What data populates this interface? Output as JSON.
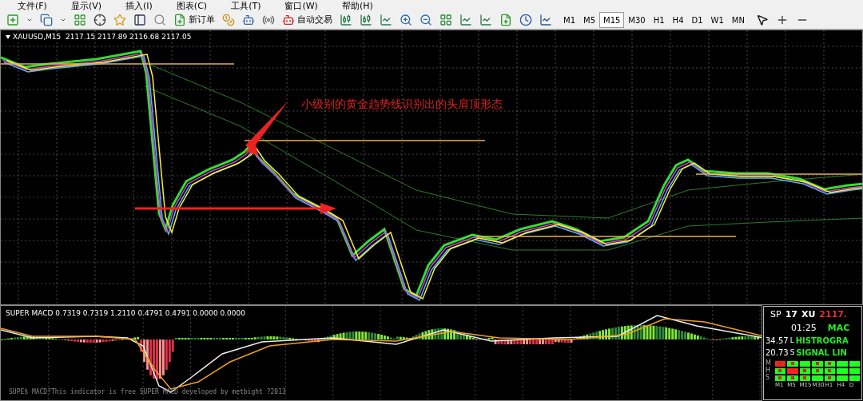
{
  "menu": [
    "文件(F)",
    "显示(V)",
    "插入(I)",
    "图表(C)",
    "工具(T)",
    "窗口(W)",
    "帮助(H)"
  ],
  "toolbar": {
    "new_order": "新订单",
    "auto_trading": "自动交易"
  },
  "timeframes": [
    {
      "label": "M1",
      "selected": false
    },
    {
      "label": "M5",
      "selected": false
    },
    {
      "label": "M15",
      "selected": true
    },
    {
      "label": "M30",
      "selected": false
    },
    {
      "label": "H1",
      "selected": false
    },
    {
      "label": "H4",
      "selected": false
    },
    {
      "label": "D1",
      "selected": false
    },
    {
      "label": "W1",
      "selected": false
    },
    {
      "label": "MN",
      "selected": false
    }
  ],
  "chart": {
    "header": "XAUUSD,M15  2117.15 2117.89 2116.68 2117.05",
    "annotation": "小级别的黄金趋势线识别出的头肩顶形态"
  },
  "indicator": {
    "header": "SUPER MACD 0.7319 0.7319 1.2110 0.4791 0.4791 0.0000 0.0000",
    "footer": "SUPE$ MACD?This indicator is free SUPER MACD developed by metbight ?2013"
  },
  "panel": {
    "spread_label": "SP",
    "spread": "17",
    "symbol": "XU",
    "price": "2117.",
    "time": "01:25",
    "macd_label": "MAC",
    "histogram_label": "HISTROGRA",
    "signal_label": "SIGNAL LIN",
    "value_1": "34.57",
    "value_1_label": "L",
    "value_2": "20.73",
    "value_2_label": "S",
    "grid_rows": [
      {
        "label": "M",
        "cells": [
          {
            "color": "#ff2020",
            "dot": true
          },
          {
            "color": "#20ff20",
            "dot": true
          },
          {
            "color": "#20ff20",
            "dot": false
          },
          {
            "color": "#20ff20",
            "dot": true
          },
          {
            "color": "#20ff20",
            "dot": true
          },
          {
            "color": "#20ff20",
            "dot": false
          },
          {
            "color": "#20ff20",
            "dot": false
          }
        ]
      },
      {
        "label": "H",
        "cells": [
          {
            "color": "#20ff20",
            "dot": true
          },
          {
            "color": "#ff2020",
            "dot": false
          },
          {
            "color": "#20ff20",
            "dot": true
          },
          {
            "color": "#20ff20",
            "dot": true
          },
          {
            "color": "#20ff20",
            "dot": true
          },
          {
            "color": "#20ff20",
            "dot": false
          },
          {
            "color": "#20ff20",
            "dot": false
          }
        ]
      },
      {
        "label": "S",
        "cells": [
          {
            "color": "#20ff20",
            "dot": true
          },
          {
            "color": "#20ff20",
            "dot": true
          },
          {
            "color": "#20ff20",
            "dot": true
          },
          {
            "color": "#20ff20",
            "dot": false
          },
          {
            "color": "#20ff20",
            "dot": true
          },
          {
            "color": "#20ff20",
            "dot": false
          },
          {
            "color": "#20ff20",
            "dot": false
          }
        ]
      }
    ],
    "grid_columns": [
      "M1",
      "M5",
      "M15",
      "M30",
      "H1",
      "H4",
      "D"
    ]
  }
}
